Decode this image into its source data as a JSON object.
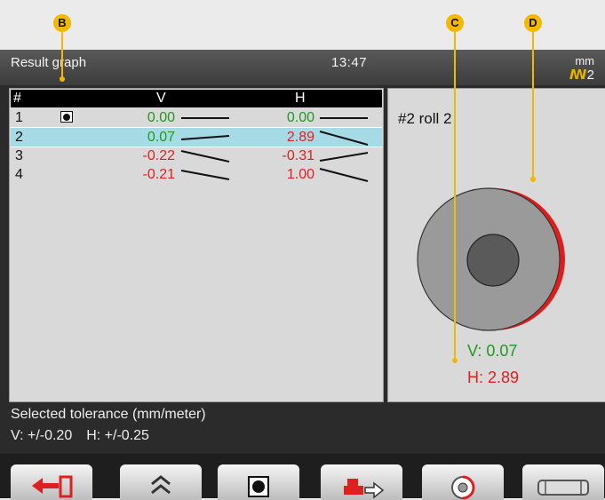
{
  "header": {
    "title": "Result graph",
    "time": "13:47",
    "unit": "mm",
    "unit_suffix": "2"
  },
  "table": {
    "columns": [
      "#",
      "V",
      "H"
    ],
    "rows": [
      {
        "num": "1",
        "v": "0.00",
        "h": "0.00",
        "v_color": "#1f9a1f",
        "h_color": "#1f9a1f"
      },
      {
        "num": "2",
        "v": "0.07",
        "h": "2.89",
        "v_color": "#1f9a1f",
        "h_color": "#e02020"
      },
      {
        "num": "3",
        "v": "-0.22",
        "h": "-0.31",
        "v_color": "#e02020",
        "h_color": "#e02020"
      },
      {
        "num": "4",
        "v": "-0.21",
        "h": "1.00",
        "v_color": "#e02020",
        "h_color": "#e02020"
      }
    ],
    "selected_index": 1
  },
  "roll": {
    "label": "#2 roll 2",
    "v_readout": "V: 0.07",
    "h_readout": "H: 2.89"
  },
  "tolerance": {
    "title": "Selected tolerance (mm/meter)",
    "v": "V: +/-0.20",
    "h": "H: +/-0.25"
  },
  "callouts": {
    "b": "B",
    "c": "C",
    "d": "D"
  },
  "toolbar": {
    "buttons": [
      "exit-icon",
      "page-up-icon",
      "reference-marker-icon",
      "move-machine-icon",
      "roll-view-icon",
      "roll-side-view-icon"
    ]
  },
  "colors": {
    "in_tolerance": "#1f9a1f",
    "out_of_tolerance": "#e02020",
    "selected_row": "#a6dbe6",
    "callout": "#f5b800"
  }
}
